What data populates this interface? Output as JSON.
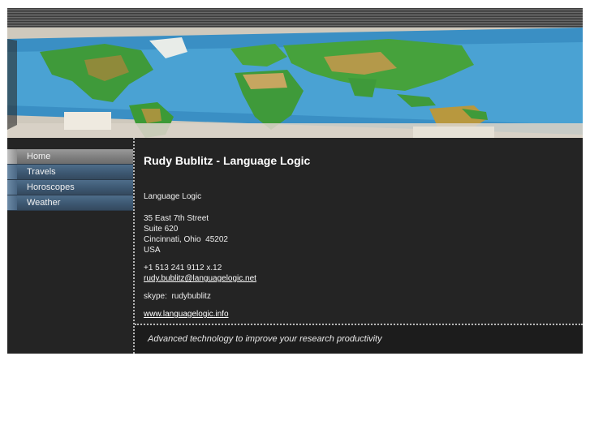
{
  "nav": {
    "items": [
      {
        "label": "Home"
      },
      {
        "label": "Travels"
      },
      {
        "label": "Horoscopes"
      },
      {
        "label": "Weather"
      }
    ]
  },
  "main": {
    "title": "Rudy Bublitz - Language Logic",
    "company": "Language Logic",
    "address": {
      "line1": "35 East 7th Street",
      "line2": "Suite 620",
      "line3": "Cincinnati, Ohio  45202",
      "line4": "USA"
    },
    "phone": "+1 513 241 9112 x.12",
    "email": "rudy.bublitz@languagelogic.net",
    "skype": "skype:  rudybublitz",
    "website": "www.languagelogic.info"
  },
  "footer": {
    "tagline": "Advanced technology to improve your research productivity"
  },
  "colors": {
    "background": "#242424",
    "nav_blue": "#3d5872",
    "nav_active": "#7e7e7e"
  }
}
